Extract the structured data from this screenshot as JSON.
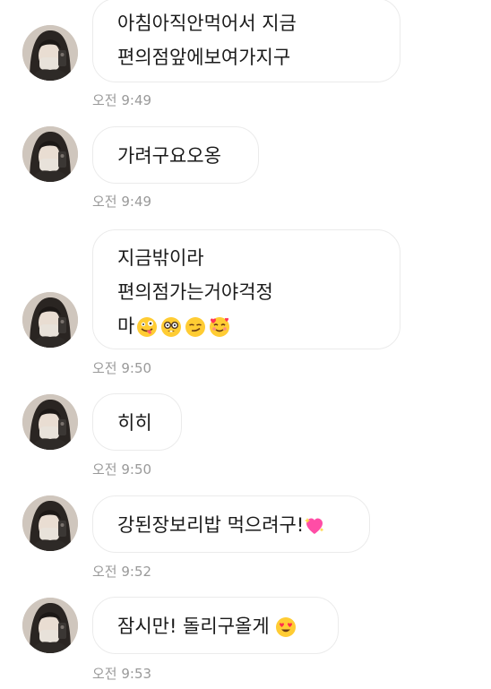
{
  "messages": [
    {
      "lines": [
        "아침아직안먹어서 지금",
        "편의점앞에보여가지구"
      ],
      "time": "오전 9:49"
    },
    {
      "lines": [
        "가려구요오옹"
      ],
      "time": "오전 9:49"
    },
    {
      "lines": [
        "지금밖이라",
        "편의점가는거야걱정",
        "마"
      ],
      "emojis": [
        "zany-face-emoji",
        "nerd-face-emoji",
        "smirking-face-emoji",
        "smiling-face-with-hearts-emoji"
      ],
      "time": "오전 9:50"
    },
    {
      "lines": [
        "히히"
      ],
      "time": "오전 9:50"
    },
    {
      "lines": [
        "강된장보리밥 먹으려구!"
      ],
      "emojis": [
        "sparkling-heart-emoji"
      ],
      "time": "오전 9:52"
    },
    {
      "lines": [
        "잠시만! 돌리구올게 "
      ],
      "emojis": [
        "heart-eyes-emoji"
      ],
      "time": "오전 9:53"
    }
  ],
  "colors": {
    "bubble_border": "#ebebeb",
    "time_text": "#9a9a9a",
    "message_text": "#1a1a1a"
  }
}
